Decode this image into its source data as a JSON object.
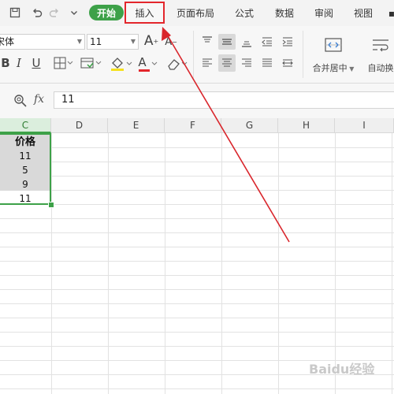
{
  "menu": {
    "start": "开始",
    "tabs": [
      "插入",
      "页面布局",
      "公式",
      "数据",
      "审阅",
      "视图"
    ]
  },
  "ribbon": {
    "font_name": "宋体",
    "font_size": "11",
    "bold": "B",
    "italic": "I",
    "underline": "U",
    "grow_font": "A",
    "shrink_font": "A",
    "font_color_glyph": "A",
    "merge_center": "合并居中",
    "auto_wrap": "自动换"
  },
  "formula_bar": {
    "fx": "fx",
    "value": "11"
  },
  "grid": {
    "columns": [
      "C",
      "D",
      "E",
      "F",
      "G",
      "H",
      "I"
    ],
    "column_c_cells": [
      "价格",
      "11",
      "5",
      "9",
      "11"
    ]
  },
  "colors": {
    "accent_green": "#3da148",
    "highlight_red": "#e3262c",
    "arrow_red": "#d9262c"
  },
  "watermark": "Baidu经验"
}
